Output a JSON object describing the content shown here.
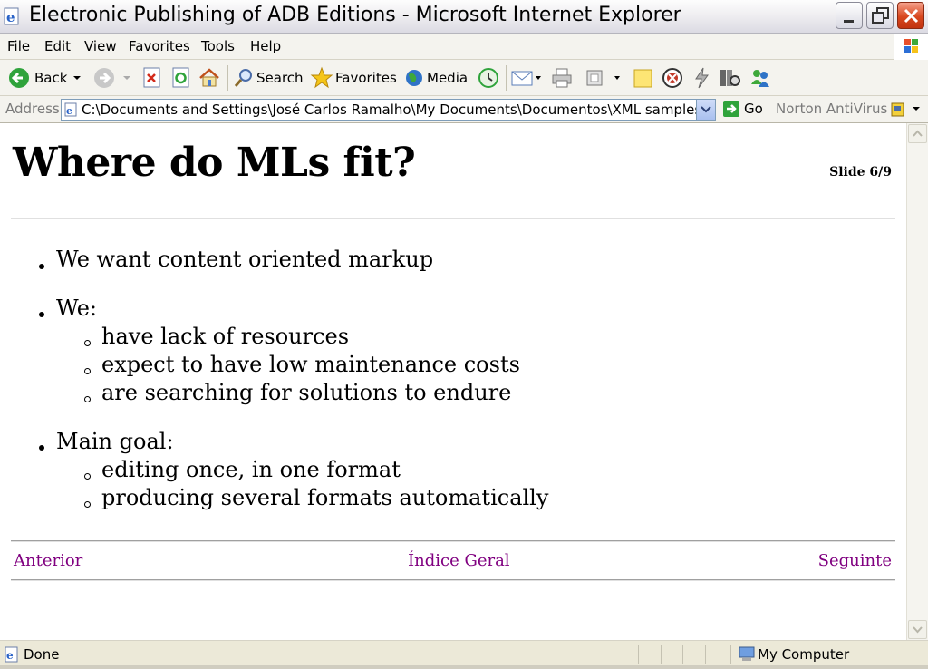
{
  "window": {
    "title": "Electronic Publishing of ADB Editions - Microsoft Internet Explorer"
  },
  "menu": [
    "File",
    "Edit",
    "View",
    "Favorites",
    "Tools",
    "Help"
  ],
  "toolbar": {
    "back": "Back",
    "search": "Search",
    "favorites": "Favorites",
    "media": "Media"
  },
  "address": {
    "label": "Address",
    "url": "C:\\Documents and Settings\\José Carlos Ramalho\\My Documents\\Documentos\\XML samples\\slid",
    "go": "Go",
    "norton": "Norton AntiVirus"
  },
  "slide": {
    "title": "Where do MLs fit?",
    "number": "Slide 6/9",
    "bullets": [
      {
        "text": "We want content oriented markup",
        "sub": []
      },
      {
        "text": "We:",
        "sub": [
          "have lack of resources",
          "expect to have low maintenance costs",
          "are searching for solutions to endure"
        ]
      },
      {
        "text": "Main goal:",
        "sub": [
          "editing once, in one format",
          "producing several formats automatically"
        ]
      }
    ]
  },
  "nav": {
    "prev": "Anterior",
    "index": "Índice Geral",
    "next": "Seguinte"
  },
  "status": {
    "text": "Done",
    "zone": "My Computer"
  }
}
